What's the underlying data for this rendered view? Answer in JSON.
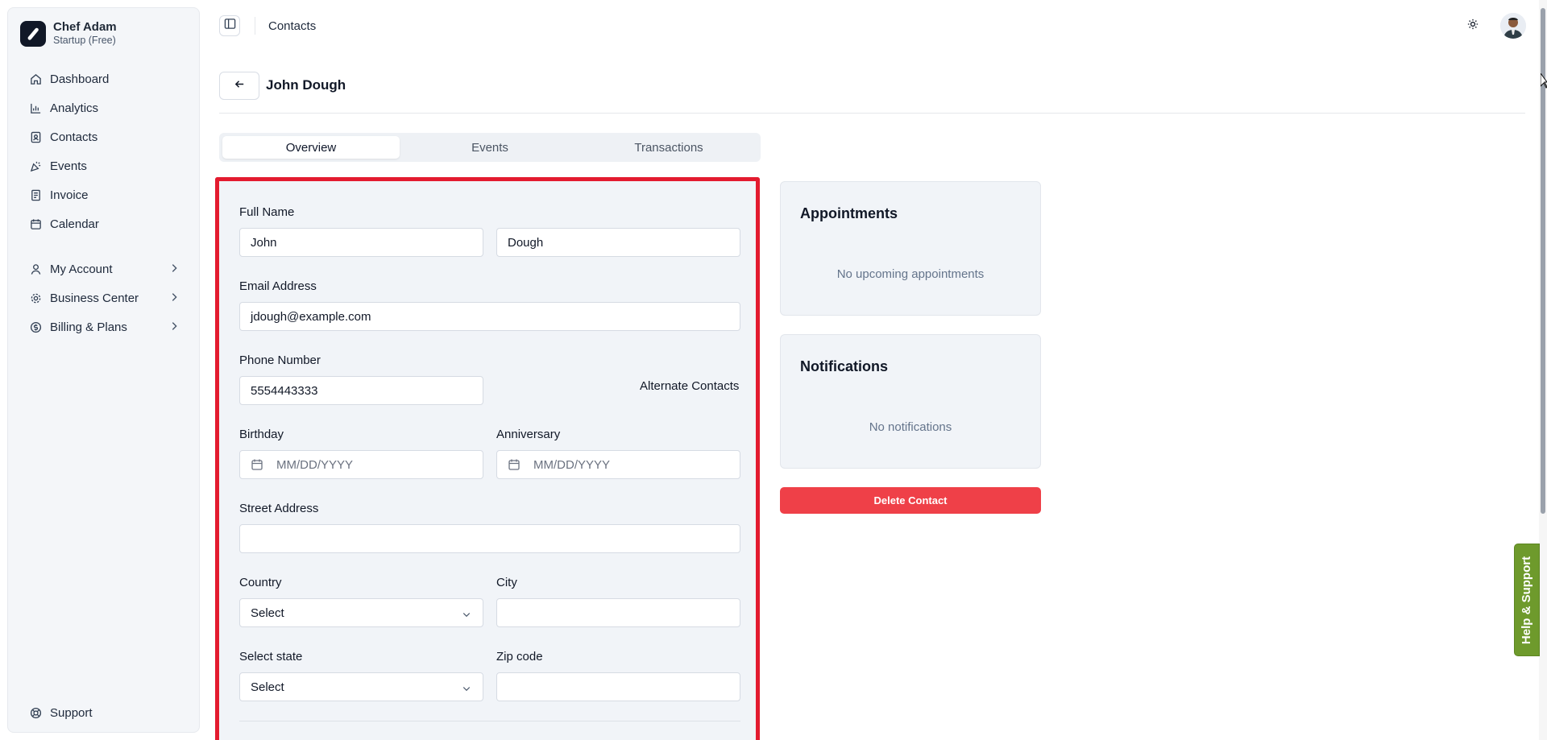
{
  "brand": {
    "name": "Chef Adam",
    "plan": "Startup (Free)"
  },
  "sidebar": {
    "items": [
      {
        "label": "Dashboard",
        "icon": "home-icon"
      },
      {
        "label": "Analytics",
        "icon": "bar-chart-icon"
      },
      {
        "label": "Contacts",
        "icon": "contacts-icon"
      },
      {
        "label": "Events",
        "icon": "party-popper-icon"
      },
      {
        "label": "Invoice",
        "icon": "receipt-icon"
      },
      {
        "label": "Calendar",
        "icon": "calendar-icon"
      }
    ],
    "groups": [
      {
        "label": "My Account",
        "icon": "user-icon"
      },
      {
        "label": "Business Center",
        "icon": "gear-icon"
      },
      {
        "label": "Billing & Plans",
        "icon": "dollar-circle-icon"
      }
    ],
    "support": {
      "label": "Support",
      "icon": "lifebuoy-icon"
    }
  },
  "topbar": {
    "title": "Contacts"
  },
  "page": {
    "title": "John Dough"
  },
  "tabs": [
    "Overview",
    "Events",
    "Transactions"
  ],
  "form": {
    "full_name_label": "Full Name",
    "first_name": "John",
    "last_name": "Dough",
    "email_label": "Email Address",
    "email": "jdough@example.com",
    "phone_label": "Phone Number",
    "phone": "5554443333",
    "alternate_contacts": "Alternate Contacts",
    "birthday_label": "Birthday",
    "birthday_placeholder": "MM/DD/YYYY",
    "anniversary_label": "Anniversary",
    "anniversary_placeholder": "MM/DD/YYYY",
    "street_label": "Street Address",
    "street": "",
    "country_label": "Country",
    "country": "Select",
    "city_label": "City",
    "city": "",
    "state_label": "Select state",
    "state": "Select",
    "zip_label": "Zip code",
    "zip": ""
  },
  "appointments": {
    "title": "Appointments",
    "empty": "No upcoming appointments"
  },
  "notifications": {
    "title": "Notifications",
    "empty": "No notifications"
  },
  "delete_button": "Delete Contact",
  "help_support": "Help & Support",
  "colors": {
    "highlight": "#e31b2f",
    "danger": "#ef4048",
    "help": "#6e9a2c"
  }
}
